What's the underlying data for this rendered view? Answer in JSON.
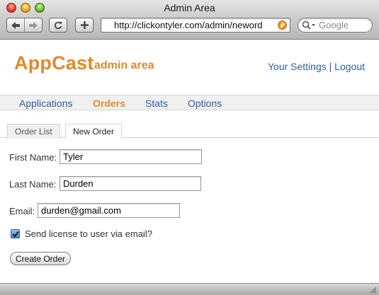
{
  "window": {
    "title": "Admin Area"
  },
  "browser": {
    "url": "http://clickontyler.com/admin/neword",
    "search_placeholder": "Google",
    "icons": {
      "back": "back-arrow-icon",
      "forward": "forward-arrow-icon",
      "reload": "reload-icon",
      "add": "plus-icon",
      "rss": "rss-icon",
      "search": "magnifier-icon"
    }
  },
  "header": {
    "brand": "AppCast",
    "subtitle": "admin area",
    "settings_link": "Your Settings",
    "separator": "|",
    "logout_link": "Logout"
  },
  "nav": {
    "items": [
      {
        "label": "Applications"
      },
      {
        "label": "Orders"
      },
      {
        "label": "Stats"
      },
      {
        "label": "Options"
      }
    ],
    "active": "Orders"
  },
  "tabs": {
    "items": [
      {
        "label": "Order List"
      },
      {
        "label": "New Order"
      }
    ],
    "active": "New Order"
  },
  "form": {
    "first_name_label": "First Name:",
    "first_name_value": "Tyler",
    "last_name_label": "Last Name:",
    "last_name_value": "Durden",
    "email_label": "Email:",
    "email_value": "durden@gmail.com",
    "send_license_label": "Send license to user via email?",
    "send_license_checked": true,
    "submit_label": "Create Order"
  },
  "colors": {
    "brand": "#e08a2c",
    "link": "#2f5fa0"
  }
}
